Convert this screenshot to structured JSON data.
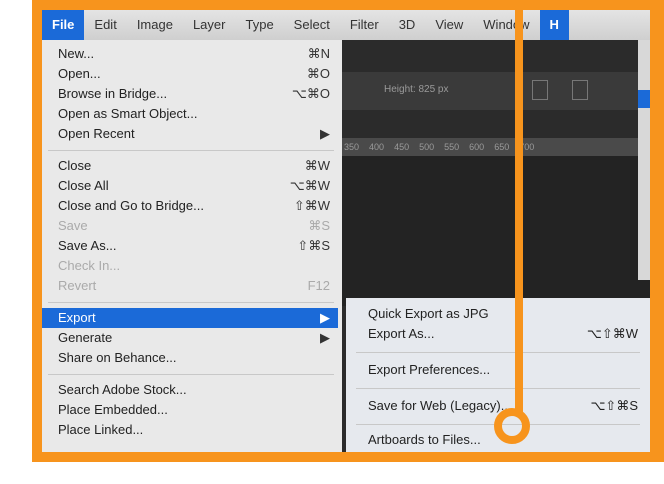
{
  "menubar": {
    "items": [
      "File",
      "Edit",
      "Image",
      "Layer",
      "Type",
      "Select",
      "Filter",
      "3D",
      "View",
      "Window",
      "H"
    ]
  },
  "options_bar": {
    "height_text": "Height: 825 px"
  },
  "ruler": {
    "labels": [
      "350",
      "400",
      "450",
      "500",
      "550",
      "600",
      "650",
      "700"
    ]
  },
  "file_menu": {
    "items": [
      {
        "label": "New...",
        "shortcut": "⌘N"
      },
      {
        "label": "Open...",
        "shortcut": "⌘O"
      },
      {
        "label": "Browse in Bridge...",
        "shortcut": "⌥⌘O"
      },
      {
        "label": "Open as Smart Object...",
        "shortcut": ""
      },
      {
        "label": "Open Recent",
        "shortcut": "▶"
      },
      {
        "label": "Close",
        "shortcut": "⌘W"
      },
      {
        "label": "Close All",
        "shortcut": "⌥⌘W"
      },
      {
        "label": "Close and Go to Bridge...",
        "shortcut": "⇧⌘W"
      },
      {
        "label": "Save",
        "shortcut": "⌘S"
      },
      {
        "label": "Save As...",
        "shortcut": "⇧⌘S"
      },
      {
        "label": "Check In...",
        "shortcut": ""
      },
      {
        "label": "Revert",
        "shortcut": "F12"
      },
      {
        "label": "Export",
        "shortcut": "▶"
      },
      {
        "label": "Generate",
        "shortcut": "▶"
      },
      {
        "label": "Share on Behance...",
        "shortcut": ""
      },
      {
        "label": "Search Adobe Stock...",
        "shortcut": ""
      },
      {
        "label": "Place Embedded...",
        "shortcut": ""
      },
      {
        "label": "Place Linked...",
        "shortcut": ""
      }
    ]
  },
  "export_submenu": {
    "items": [
      {
        "label": "Quick Export as JPG",
        "shortcut": ""
      },
      {
        "label": "Export As...",
        "shortcut": "⌥⇧⌘W"
      },
      {
        "label": "Export Preferences...",
        "shortcut": ""
      },
      {
        "label": "Save for Web (Legacy)...",
        "shortcut": "⌥⇧⌘S"
      },
      {
        "label": "Artboards to Files...",
        "shortcut": ""
      }
    ]
  },
  "colors": {
    "highlight": "#f7941d",
    "selection": "#1b6ad8"
  }
}
